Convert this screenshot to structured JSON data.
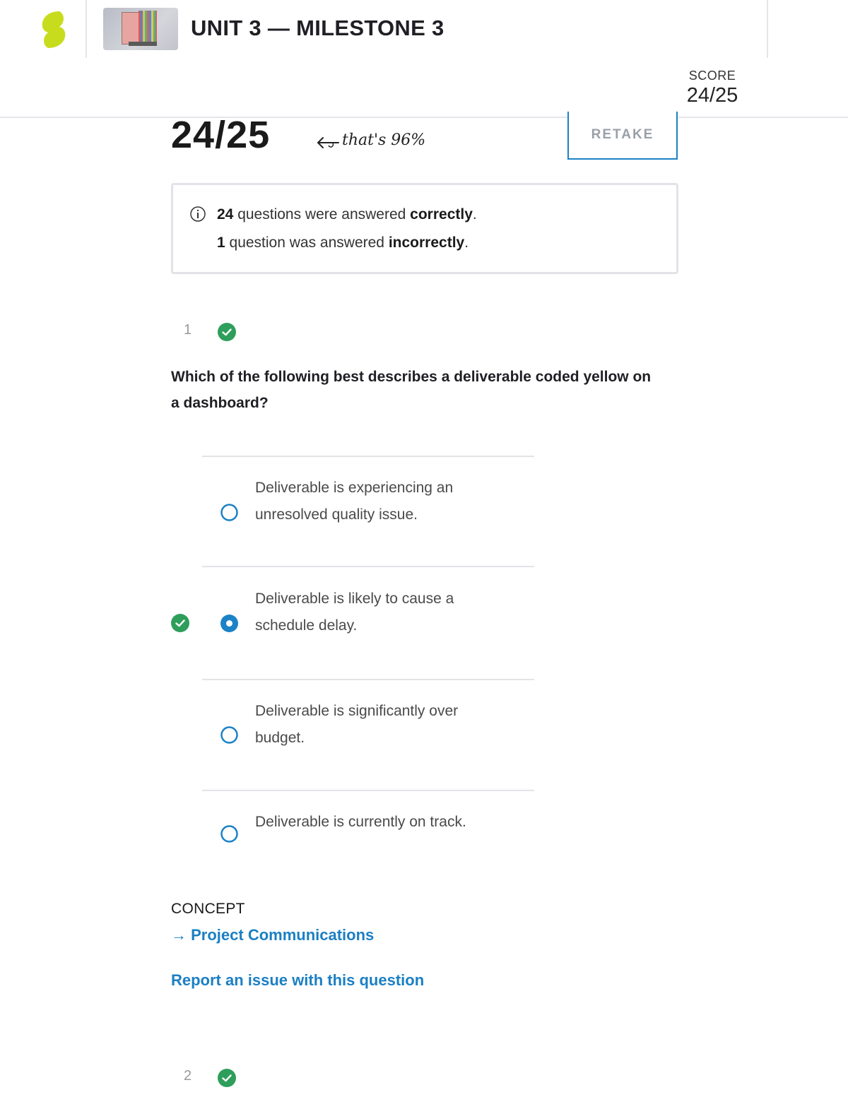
{
  "header": {
    "title": "UNIT 3 — MILESTONE 3",
    "score_label": "SCORE",
    "score_value": "24/25"
  },
  "result": {
    "big_score": "24/25",
    "note": "that's 96%",
    "retake_label": "RETAKE"
  },
  "summary": {
    "correct_count": "24",
    "correct_pre": " questions were answered ",
    "correct_word": "correctly",
    "incorrect_count": "1",
    "incorrect_pre": " question was answered ",
    "incorrect_word": "incorrectly",
    "period": "."
  },
  "question1": {
    "number": "1",
    "status": "correct",
    "text": "Which of the following best describes a deliverable coded yellow on a dashboard?",
    "options": [
      {
        "text": "Deliverable is experiencing an unresolved quality issue.",
        "selected": false,
        "correct_mark": false
      },
      {
        "text": "Deliverable is likely to cause a schedule delay.",
        "selected": true,
        "correct_mark": true
      },
      {
        "text": "Deliverable is significantly over budget.",
        "selected": false,
        "correct_mark": false
      },
      {
        "text": "Deliverable is currently on track.",
        "selected": false,
        "correct_mark": false
      }
    ],
    "concept_label": "CONCEPT",
    "concept_arrow": "→",
    "concept_link": "Project Communications",
    "report_link": "Report an issue with this question"
  },
  "question2": {
    "number": "2",
    "status": "correct"
  },
  "colors": {
    "accent": "#1b82c6",
    "success": "#2e9e5b",
    "logo": "#c8dc1e"
  },
  "icons": [
    "logo-icon",
    "info-icon",
    "check-circle-icon",
    "radio-icon",
    "arrow-left-icon"
  ]
}
